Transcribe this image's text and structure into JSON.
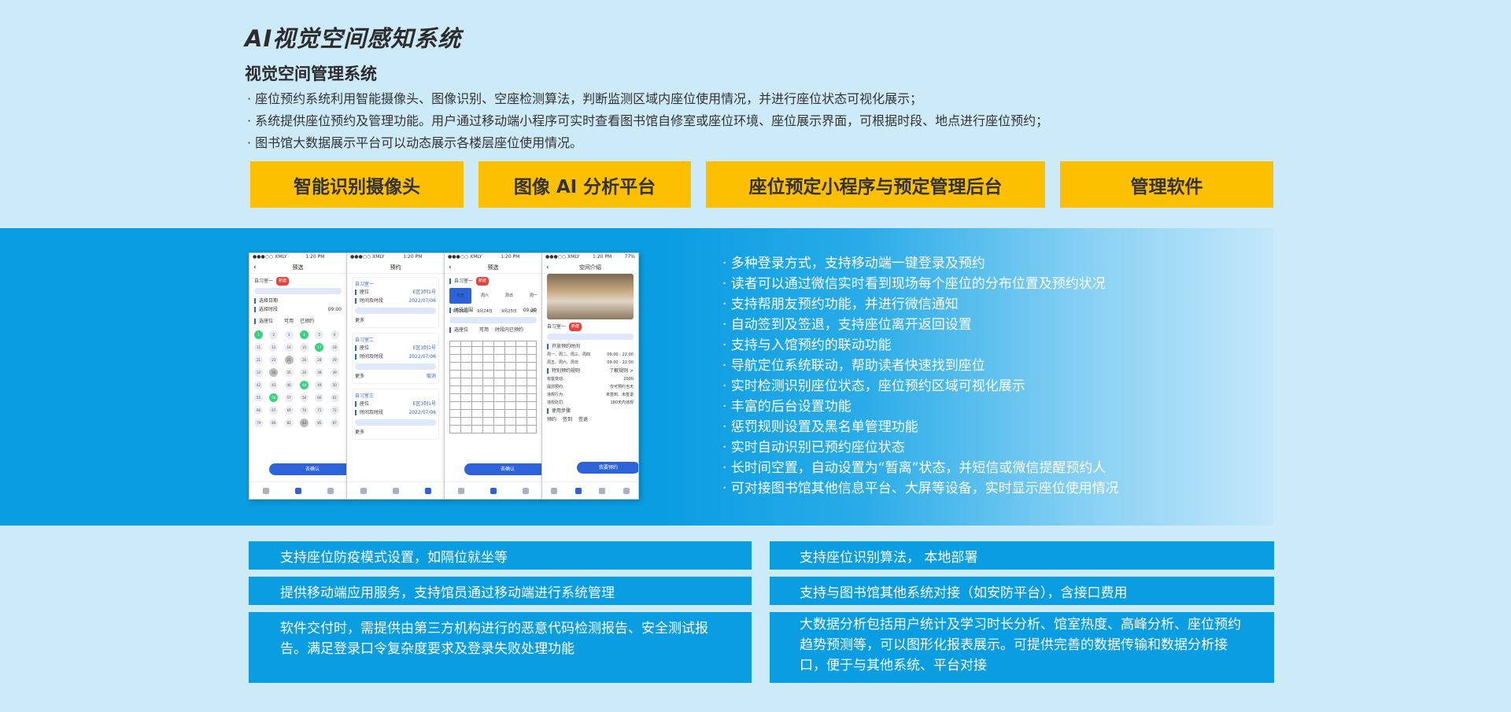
{
  "header": {
    "title": "AI视觉空间感知系统",
    "subtitle": "视觉空间管理系统",
    "intro": [
      "· 座位预约系统利用智能摄像头、图像识别、空座检测算法，判断监测区域内座位使用情况，并进行座位状态可视化展示；",
      "· 系统提供座位预约及管理功能。用户通过移动端小程序可实时查看图书馆自修室或座位环境、座位展示界面，可根据时段、地点进行座位预约；",
      "· 图书馆大数据展示平台可以动态展示各楼层座位使用情况。"
    ]
  },
  "modules": [
    "智能识别摄像头",
    "图像 AI 分析平台",
    "座位预定小程序与预定管理后台",
    "管理软件"
  ],
  "phones": {
    "status_carrier": "●●●○○ XMLY",
    "status_time": "1:20 PM",
    "p1": {
      "nav": "预选",
      "room": "自习室一",
      "tag": "新建",
      "date_label": "选择日期",
      "time_label": "选择时段",
      "time_val": "09:00",
      "filter_label": "选座位",
      "opt1": "可用",
      "opt2": "已预约",
      "confirm": "去确认"
    },
    "p2": {
      "nav": "预约",
      "r1": "自习室一",
      "r2": "自习室二",
      "r3": "自习室三",
      "seat_label": "座位",
      "seat_val": "E区3列1号",
      "time_label": "时间及时段",
      "time_val": "2022/07/06",
      "more": "更多",
      "cancel": "取消"
    },
    "p3": {
      "nav": "预选",
      "room": "自习室一",
      "tag": "新建",
      "d1a": "今天",
      "d1b": "9月23日",
      "d2a": "周六",
      "d2b": "9月24日",
      "d3a": "周日",
      "d3b": "9月25日",
      "d4a": "周一",
      "d4b": "9月",
      "range_label": "时段范围",
      "range_val": "09:30",
      "filter_label": "选座位",
      "opt1": "可用",
      "opt2": "时段内已预约",
      "confirm": "去确认"
    },
    "p4": {
      "nav": "空间介绍",
      "battery": "77%",
      "room": "自习室一",
      "tag": "新建",
      "open_label": "开放预约时间",
      "t1k": "周一、周二、周三、周四",
      "t1v": "09:00 - 22:00",
      "t2k": "周五、周六、周日",
      "t2v": "09:00 - 22:00",
      "rules_label": "特别预约规则",
      "rules_more": "了解规则 >",
      "k1": "有座变动:",
      "v1": "2000",
      "k2": "提前预约:",
      "v2": "仅可预约当天",
      "k3": "违规行为:",
      "v3": "未签到、未签退",
      "k4": "违规处罚:",
      "v4": "180天内违规",
      "steps_label": "使用步骤",
      "s1": "预约",
      "s2": "签到",
      "s3": "签退",
      "btn": "我要预约"
    }
  },
  "features": [
    "· 多种登录方式，支持移动端一键登录及预约",
    "· 读者可以通过微信实时看到现场每个座位的分布位置及预约状况",
    "· 支持帮朋友预约功能，并进行微信通知",
    "· 自动签到及签退，支持座位离开返回设置",
    "· 支持与入馆预约的联动功能",
    "· 导航定位系统联动，帮助读者快速找到座位",
    "· 实时检测识别座位状态，座位预约区域可视化展示",
    "· 丰富的后台设置功能",
    "· 惩罚规则设置及黑名单管理功能",
    "· 实时自动识别已预约座位状态",
    "· 长时间空置，自动设置为“暂离”状态，并短信或微信提醒预约人",
    "· 可对接图书馆其他信息平台、大屏等设备，实时显示座位使用情况"
  ],
  "bottom_left": [
    "支持座位防疫模式设置，如隔位就坐等",
    "提供移动端应用服务，支持馆员通过移动端进行系统管理",
    "软件交付时，需提供由第三方机构进行的恶意代码检测报告、安全测试报告。满足登录口令复杂度要求及登录失败处理功能"
  ],
  "bottom_right": [
    "支持座位识别算法， 本地部署",
    "支持与图书馆其他系统对接（如安防平台），含接口费用",
    "大数据分析包括用户统计及学习时长分析、馆室热度、高峰分析、座位预约趋势预测等，可以图形化报表展示。可提供完善的数据传输和数据分析接口，便于与其他系统、平台对接"
  ],
  "colors": {
    "background": "#cdeaf9",
    "accent_yellow": "#fdc000",
    "accent_blue": "#0a9de2",
    "app_blue": "#2c63d8",
    "seat_green": "#3ad17e"
  }
}
